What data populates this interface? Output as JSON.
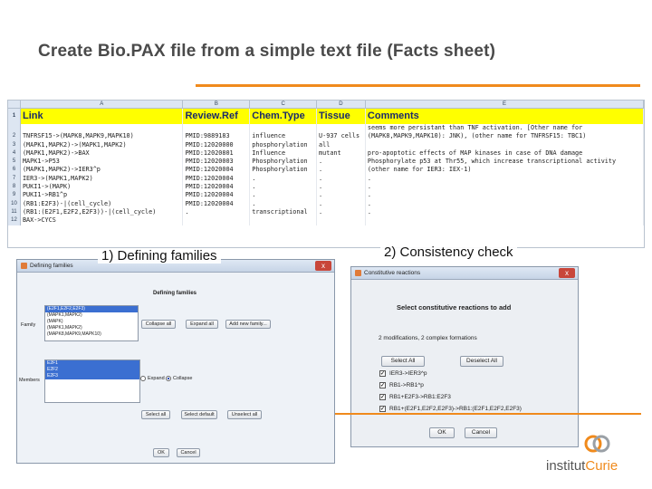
{
  "slide": {
    "title": "Create Bio.PAX file from a simple text file (Facts sheet)"
  },
  "sheet": {
    "columns": [
      "A",
      "B",
      "C",
      "D",
      "E"
    ],
    "header": {
      "row": "1",
      "cells": [
        "Link",
        "Review.Ref",
        "Chem.Type",
        "Tissue",
        "Comments"
      ]
    },
    "row_numbers": [
      "2",
      "3",
      "4",
      "5",
      "6",
      "7",
      "8",
      "9",
      "10",
      "11",
      "12",
      "13"
    ],
    "comment_row2_line1": "seems more persistant than TNF activation. [Other name for",
    "comment_row2_line2": "(MAPK8,MAPK9,MAPK10): JNK), (other name for TNFRSF15: TBC1)",
    "rows": [
      [
        "TNFRSF15->(MAPK8,MAPK9,MAPK10)",
        "PMID:9889183",
        "influence",
        "U-937 cells",
        ""
      ],
      [
        "(MAPK1,MAPK2)->(MAPK1,MAPK2)",
        "PMID:12020000",
        "phosphorylation",
        "all",
        ""
      ],
      [
        "(MAPK1,MAPK2)->BAX",
        "PMID:12020801",
        "Influence",
        "mutant",
        "pro-apoptotic effects of MAP kinases in case of DNA damage"
      ],
      [
        "MAPK1->P53",
        "PMID:12020003",
        "Phosphorylation",
        ".",
        "Phosphorylate p53 at Thr55, which increase transcriptional activity"
      ],
      [
        "(MAPK1,MAPK2)->IER3^p",
        "PMID:12020004",
        "Phosphorylation",
        ".",
        "(other name for IER3: IEX-1)"
      ],
      [
        "IER3->(MAPK1,MAPK2)",
        "PMID:12020004",
        ".",
        ".",
        "."
      ],
      [
        "PUKI1->(MAPK)",
        "PMID:12020004",
        ".",
        ".",
        "."
      ],
      [
        "PUKI1->RB1^p",
        "PMID:12020004",
        ".",
        ".",
        "."
      ],
      [
        "(RB1:E2F3)-|(cell_cycle)",
        "PMID:12020004",
        ".",
        ".",
        "."
      ],
      [
        "(RB1:(E2F1,E2F2,E2F3))-|(cell_cycle)",
        ".",
        "transcriptional",
        ".",
        "."
      ],
      [
        "BAX->CYCS",
        "",
        "",
        "",
        ""
      ]
    ]
  },
  "captions": {
    "families": "1) Defining families",
    "consistency": "2) Consistency check"
  },
  "families_window": {
    "title": "Defining families",
    "close": "x",
    "headline": "Defining families",
    "family_label": "Family",
    "members_label": "Members",
    "families": [
      "(E2F1,E2F2,E2F3)",
      "(MAPK1,MAPK2)",
      "(MAPK)",
      "(MAPK1,MAPK2)",
      "(MAPK8,MAPK9,MAPK10)"
    ],
    "members": [
      "E2F1",
      "E2F2",
      "E2F3"
    ],
    "buttons": {
      "collapse_all": "Collapse all",
      "expand_all": "Expand all",
      "add_new_family": "Add new family..."
    },
    "radio": {
      "expand": "Expand",
      "collapse": "Collapse"
    },
    "select_all": "Select all",
    "select_default": "Select default",
    "unselect_all": "Unselect all",
    "ok": "OK",
    "cancel": "Cancel"
  },
  "constitutive_window": {
    "title": "Constitutive reactions",
    "close": "x",
    "headline": "Select constitutive reactions to add",
    "subline": "2 modifications, 2 complex formations",
    "select_all": "Select All",
    "deselect_all": "Deselect All",
    "reactions": [
      "IER3->IER3^p",
      "RB1->RB1^p",
      "RB1+E2F3->RB1:E2F3",
      "RB1+(E2F1,E2F2,E2F3)->RB1:(E2F1,E2F2,E2F3)"
    ],
    "ok": "OK",
    "cancel": "Cancel"
  },
  "logo": {
    "prefix": "institut",
    "name": "Curie"
  },
  "colors": {
    "accent": "#f08a1c",
    "sheet_header": "#ffff00",
    "selection": "#3b6fd1"
  }
}
